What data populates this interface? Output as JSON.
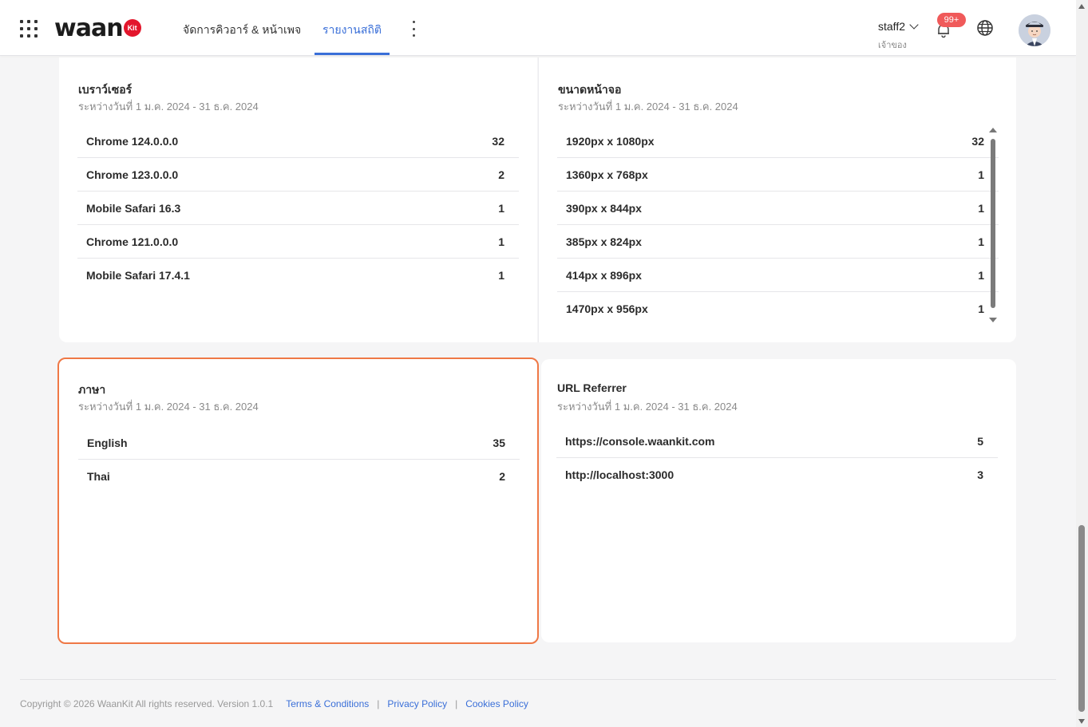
{
  "header": {
    "logo_text": "waan",
    "logo_badge": "Kit",
    "nav": [
      {
        "label": "จัดการคิวอาร์ & หน้าเพจ"
      },
      {
        "label": "รายงานสถิติ",
        "active": true
      }
    ],
    "user_name": "staff2",
    "user_role": "เจ้าของ",
    "notification_badge": "99+",
    "icons": [
      "apps-grid-icon",
      "more-vertical-icon",
      "bell-icon",
      "globe-icon",
      "avatar"
    ],
    "accent_color": "#3a6fd8",
    "badge_color": "#f05a5a"
  },
  "cards": {
    "browser": {
      "title": "เบราว์เซอร์",
      "subtitle": "ระหว่างวันที่ 1 ม.ค. 2024 - 31 ธ.ค. 2024",
      "rows": [
        {
          "label": "Chrome 124.0.0.0",
          "count": "32"
        },
        {
          "label": "Chrome 123.0.0.0",
          "count": "2"
        },
        {
          "label": "Mobile Safari 16.3",
          "count": "1"
        },
        {
          "label": "Chrome 121.0.0.0",
          "count": "1"
        },
        {
          "label": "Mobile Safari 17.4.1",
          "count": "1"
        }
      ]
    },
    "screen": {
      "title": "ขนาดหน้าจอ",
      "subtitle": "ระหว่างวันที่ 1 ม.ค. 2024 - 31 ธ.ค. 2024",
      "rows": [
        {
          "label": "1920px x 1080px",
          "count": "32"
        },
        {
          "label": "1360px x 768px",
          "count": "1"
        },
        {
          "label": "390px x 844px",
          "count": "1"
        },
        {
          "label": "385px x 824px",
          "count": "1"
        },
        {
          "label": "414px x 896px",
          "count": "1"
        },
        {
          "label": "1470px x 956px",
          "count": "1"
        }
      ]
    },
    "language": {
      "title": "ภาษา",
      "subtitle": "ระหว่างวันที่ 1 ม.ค. 2024 - 31 ธ.ค. 2024",
      "highlight_color": "#ef7846",
      "rows": [
        {
          "label": "English",
          "count": "35"
        },
        {
          "label": "Thai",
          "count": "2"
        }
      ]
    },
    "referrer": {
      "title": "URL Referrer",
      "subtitle": "ระหว่างวันที่ 1 ม.ค. 2024 - 31 ธ.ค. 2024",
      "rows": [
        {
          "label": "https://console.waankit.com",
          "count": "5"
        },
        {
          "label": "http://localhost:3000",
          "count": "3"
        }
      ]
    }
  },
  "footer": {
    "copyright": "Copyright © 2026 WaanKit All rights reserved. Version 1.0.1",
    "links": [
      "Terms & Conditions",
      "Privacy Policy",
      "Cookies Policy"
    ],
    "separator": "|"
  }
}
